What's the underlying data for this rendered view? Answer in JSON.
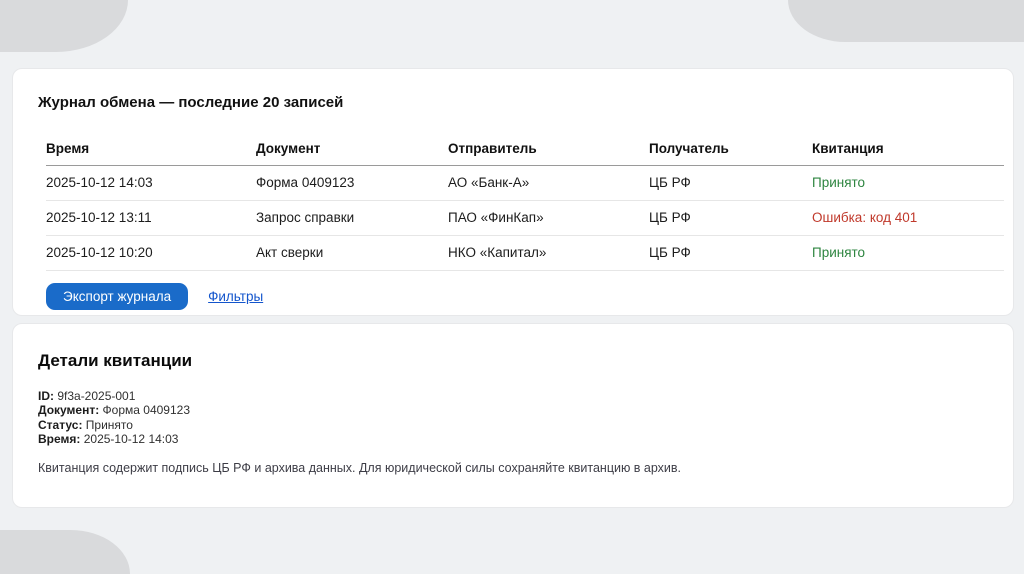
{
  "journal_card": {
    "title": "Журнал обмена — последние 20 записей",
    "table": {
      "columns": [
        "Время",
        "Документ",
        "Отправитель",
        "Получатель",
        "Квитанция"
      ],
      "rows": [
        {
          "time": "2025-10-12 14:03",
          "doc": "Форма 0409123",
          "sender": "АО «Банк-А»",
          "receiver": "ЦБ РФ",
          "status": "Принято",
          "status_type": "ok"
        },
        {
          "time": "2025-10-12 13:11",
          "doc": "Запрос справки",
          "sender": "ПАО «ФинКап»",
          "receiver": "ЦБ РФ",
          "status": "Ошибка: код 401",
          "status_type": "error"
        },
        {
          "time": "2025-10-12 10:20",
          "doc": "Акт сверки",
          "sender": "НКО «Капитал»",
          "receiver": "ЦБ РФ",
          "status": "Принято",
          "status_type": "ok"
        }
      ]
    },
    "export_button_label": "Экспорт журнала",
    "filters_link_label": "Фильтры"
  },
  "details_card": {
    "title": "Детали квитанции",
    "fields": [
      {
        "label": "ID:",
        "value": "9f3a-2025-001"
      },
      {
        "label": "Документ:",
        "value": "Форма 0409123"
      },
      {
        "label": "Статус:",
        "value": "Принято"
      },
      {
        "label": "Время:",
        "value": "2025-10-12 14:03"
      }
    ],
    "note": "Квитанция содержит подпись ЦБ РФ и архива данных. Для юридической силы сохраняйте квитанцию в архив."
  },
  "colors": {
    "accent": "#1a6bc9",
    "link": "#1355cc",
    "status_ok": "#2e8540",
    "status_error": "#c0392b"
  }
}
